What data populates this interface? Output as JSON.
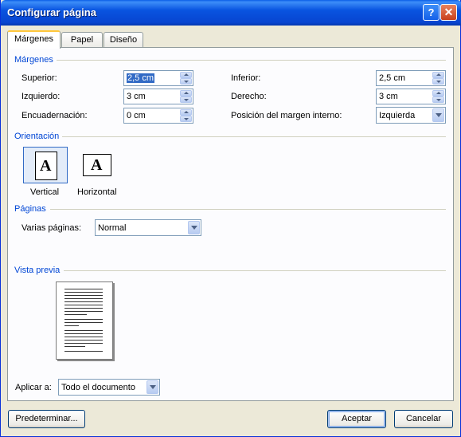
{
  "window": {
    "title": "Configurar página",
    "help_glyph": "?",
    "close_glyph": "✕"
  },
  "tabs": [
    {
      "label": "Márgenes",
      "active": true
    },
    {
      "label": "Papel",
      "active": false
    },
    {
      "label": "Diseño",
      "active": false
    }
  ],
  "margins": {
    "section": "Márgenes",
    "superior": {
      "label": "Superior:",
      "value": "2,5 cm"
    },
    "inferior": {
      "label": "Inferior:",
      "value": "2,5 cm"
    },
    "izquierdo": {
      "label": "Izquierdo:",
      "value": "3 cm"
    },
    "derecho": {
      "label": "Derecho:",
      "value": "3 cm"
    },
    "encuadernacion": {
      "label": "Encuadernación:",
      "value": "0 cm"
    },
    "posicion": {
      "label": "Posición del margen interno:",
      "value": "Izquierda"
    }
  },
  "orientation": {
    "section": "Orientación",
    "vertical": {
      "label": "Vertical",
      "glyph": "A",
      "selected": true
    },
    "horizontal": {
      "label": "Horizontal",
      "glyph": "A",
      "selected": false
    }
  },
  "pages": {
    "section": "Páginas",
    "multiple": {
      "label": "Varias páginas:",
      "value": "Normal"
    }
  },
  "preview": {
    "section": "Vista previa"
  },
  "apply": {
    "label": "Aplicar a:",
    "value": "Todo el documento"
  },
  "buttons": {
    "default": "Predeterminar...",
    "ok": "Aceptar",
    "cancel": "Cancelar"
  },
  "colors": {
    "titlebar": "#0954E0",
    "section_text": "#0046D5",
    "dialog_bg": "#ECE9D8",
    "selection": "#316AC5"
  }
}
